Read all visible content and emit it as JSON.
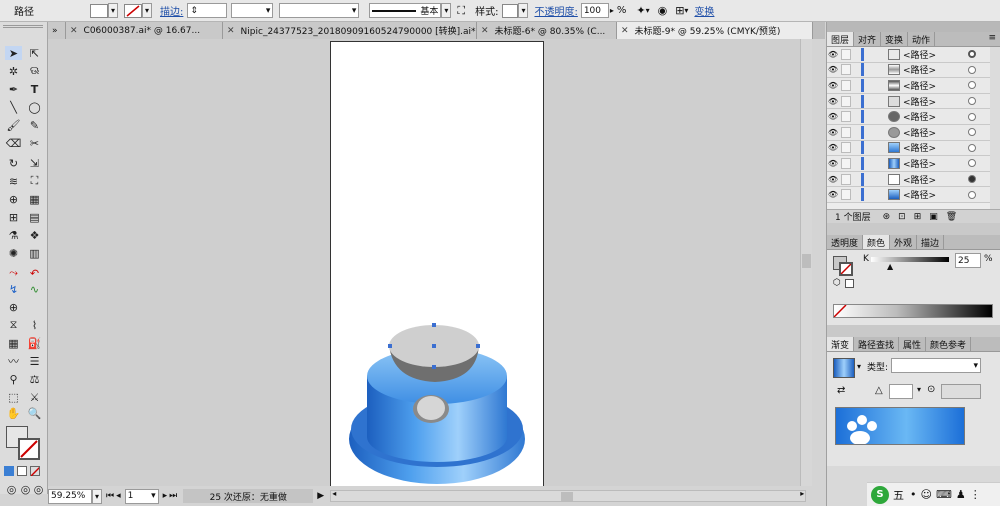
{
  "control_bar": {
    "object_type": "路径",
    "stroke_label": "描边:",
    "stroke_profile": "基本",
    "style_label": "样式:",
    "opacity_label": "不透明度:",
    "opacity_value": "100",
    "opacity_unit": "%",
    "transform_label": "变换"
  },
  "tabs": [
    {
      "label": "C06000387.ai* @ 16.67...",
      "active": false
    },
    {
      "label": "Nipic_24377523_20180909160524790000 [转换].ai*",
      "active": false
    },
    {
      "label": "未标题-6* @ 80.35% (C...",
      "active": false
    },
    {
      "label": "未标题-9* @ 59.25% (CMYK/预览)",
      "active": true
    }
  ],
  "layers_panel": {
    "tabs": [
      "图层",
      "对齐",
      "变换",
      "动作"
    ],
    "rows": [
      "<路径>",
      "<路径>",
      "<路径>",
      "<路径>",
      "<路径>",
      "<路径>",
      "<路径>",
      "<路径>",
      "<路径>",
      "<路径>"
    ],
    "footer_label": "1 个图层"
  },
  "color_panel": {
    "tabs": [
      "透明度",
      "颜色",
      "外观",
      "描边"
    ],
    "channel_label": "K",
    "channel_value": "25",
    "channel_unit": "%"
  },
  "gradient_panel": {
    "tabs": [
      "渐变",
      "路径查找",
      "属性",
      "颜色参考"
    ],
    "type_label": "类型:"
  },
  "status_bar": {
    "zoom": "59.25%",
    "artboard_number": "1",
    "status_text": "25 次还原：无重做"
  },
  "taskbar": {
    "ime_label": "五"
  },
  "colors": {
    "accent_blue": "#3b7fd4",
    "panel_bg": "#d9d9d9",
    "canvas_bg": "#cfcfcf"
  }
}
